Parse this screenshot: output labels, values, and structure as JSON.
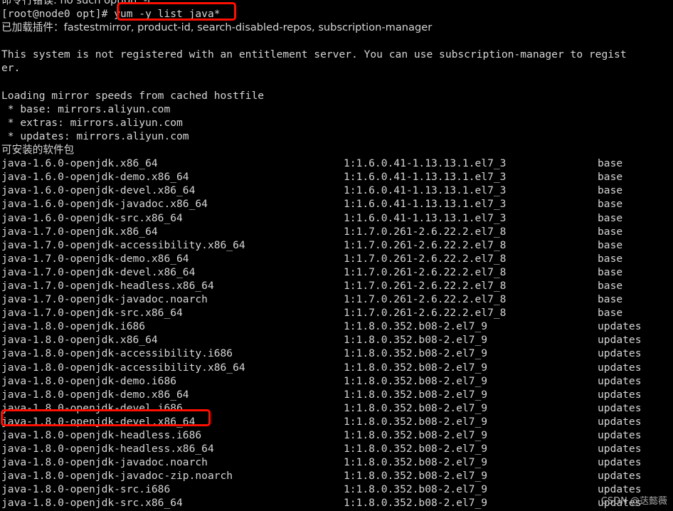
{
  "terminal": {
    "background_color": "#000000",
    "foreground_color": "#d6d6d6",
    "highlight_color": "#ff0f00",
    "clipped_top_line": "命令行错误: no such option: -t",
    "prompt_line": "[root@node0 opt]# ",
    "command": "yum -y list java*",
    "plugins_line": "已加载插件：fastestmirror, product-id, search-disabled-repos, subscription-manager",
    "blank": "",
    "entitlement_line_1": "This system is not registered with an entitlement server. You can use subscription-manager to regist",
    "entitlement_line_2": "er.",
    "loading_line": "Loading mirror speeds from cached hostfile",
    "mirrors": [
      " * base: mirrors.aliyun.com",
      " * extras: mirrors.aliyun.com",
      " * updates: mirrors.aliyun.com"
    ],
    "available_header": "可安装的软件包",
    "packages": [
      {
        "name": "java-1.6.0-openjdk.x86_64",
        "version": "1:1.6.0.41-1.13.13.1.el7_3",
        "repo": "base"
      },
      {
        "name": "java-1.6.0-openjdk-demo.x86_64",
        "version": "1:1.6.0.41-1.13.13.1.el7_3",
        "repo": "base"
      },
      {
        "name": "java-1.6.0-openjdk-devel.x86_64",
        "version": "1:1.6.0.41-1.13.13.1.el7_3",
        "repo": "base"
      },
      {
        "name": "java-1.6.0-openjdk-javadoc.x86_64",
        "version": "1:1.6.0.41-1.13.13.1.el7_3",
        "repo": "base"
      },
      {
        "name": "java-1.6.0-openjdk-src.x86_64",
        "version": "1:1.6.0.41-1.13.13.1.el7_3",
        "repo": "base"
      },
      {
        "name": "java-1.7.0-openjdk.x86_64",
        "version": "1:1.7.0.261-2.6.22.2.el7_8",
        "repo": "base"
      },
      {
        "name": "java-1.7.0-openjdk-accessibility.x86_64",
        "version": "1:1.7.0.261-2.6.22.2.el7_8",
        "repo": "base"
      },
      {
        "name": "java-1.7.0-openjdk-demo.x86_64",
        "version": "1:1.7.0.261-2.6.22.2.el7_8",
        "repo": "base"
      },
      {
        "name": "java-1.7.0-openjdk-devel.x86_64",
        "version": "1:1.7.0.261-2.6.22.2.el7_8",
        "repo": "base"
      },
      {
        "name": "java-1.7.0-openjdk-headless.x86_64",
        "version": "1:1.7.0.261-2.6.22.2.el7_8",
        "repo": "base"
      },
      {
        "name": "java-1.7.0-openjdk-javadoc.noarch",
        "version": "1:1.7.0.261-2.6.22.2.el7_8",
        "repo": "base"
      },
      {
        "name": "java-1.7.0-openjdk-src.x86_64",
        "version": "1:1.7.0.261-2.6.22.2.el7_8",
        "repo": "base"
      },
      {
        "name": "java-1.8.0-openjdk.i686",
        "version": "1:1.8.0.352.b08-2.el7_9",
        "repo": "updates"
      },
      {
        "name": "java-1.8.0-openjdk.x86_64",
        "version": "1:1.8.0.352.b08-2.el7_9",
        "repo": "updates"
      },
      {
        "name": "java-1.8.0-openjdk-accessibility.i686",
        "version": "1:1.8.0.352.b08-2.el7_9",
        "repo": "updates"
      },
      {
        "name": "java-1.8.0-openjdk-accessibility.x86_64",
        "version": "1:1.8.0.352.b08-2.el7_9",
        "repo": "updates"
      },
      {
        "name": "java-1.8.0-openjdk-demo.i686",
        "version": "1:1.8.0.352.b08-2.el7_9",
        "repo": "updates"
      },
      {
        "name": "java-1.8.0-openjdk-demo.x86_64",
        "version": "1:1.8.0.352.b08-2.el7_9",
        "repo": "updates"
      },
      {
        "name": "java-1.8.0-openjdk-devel.i686",
        "version": "1:1.8.0.352.b08-2.el7_9",
        "repo": "updates"
      },
      {
        "name": "java-1.8.0-openjdk-devel.x86_64",
        "version": "1:1.8.0.352.b08-2.el7_9",
        "repo": "updates"
      },
      {
        "name": "java-1.8.0-openjdk-headless.i686",
        "version": "1:1.8.0.352.b08-2.el7_9",
        "repo": "updates"
      },
      {
        "name": "java-1.8.0-openjdk-headless.x86_64",
        "version": "1:1.8.0.352.b08-2.el7_9",
        "repo": "updates"
      },
      {
        "name": "java-1.8.0-openjdk-javadoc.noarch",
        "version": "1:1.8.0.352.b08-2.el7_9",
        "repo": "updates"
      },
      {
        "name": "java-1.8.0-openjdk-javadoc-zip.noarch",
        "version": "1:1.8.0.352.b08-2.el7_9",
        "repo": "updates"
      },
      {
        "name": "java-1.8.0-openjdk-src.i686",
        "version": "1:1.8.0.352.b08-2.el7_9",
        "repo": "updates"
      },
      {
        "name": "java-1.8.0-openjdk-src.x86_64",
        "version": "1:1.8.0.352.b08-2.el7_9",
        "repo": "updates"
      }
    ]
  },
  "annotations": {
    "command_box_label": "yum -y list java*",
    "package_box_label": "java-1.8.0-openjdk-devel.x86_64"
  },
  "watermark": {
    "front": "CSDN @荙懿薇",
    "back": "updates"
  }
}
